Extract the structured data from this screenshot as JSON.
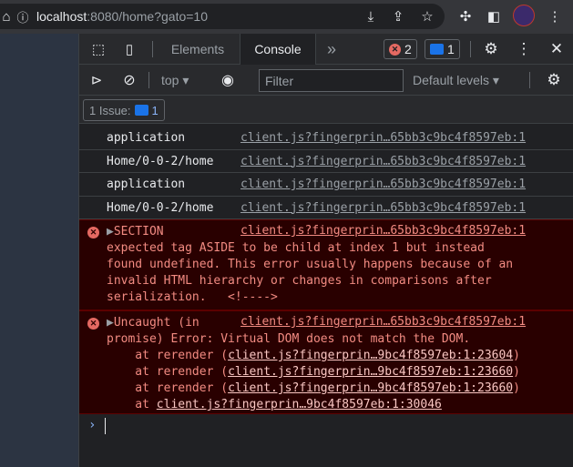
{
  "browser": {
    "url_host": "localhost",
    "url_rest": ":8080/home?gato=10"
  },
  "devtools": {
    "tabs": [
      "Elements",
      "Console"
    ],
    "more_tabs": "»",
    "error_count": "2",
    "message_count": "1",
    "context": "top",
    "filter_placeholder": "Filter",
    "levels": "Default levels",
    "issues_label": "1 Issue:",
    "issues_count": "1"
  },
  "console": {
    "logs": [
      {
        "message": "application",
        "source": "client.js?fingerprin…65bb3c9bc4f8597eb:1"
      },
      {
        "message": "Home/0-0-2/home",
        "source": "client.js?fingerprin…65bb3c9bc4f8597eb:1"
      },
      {
        "message": "application",
        "source": "client.js?fingerprin…65bb3c9bc4f8597eb:1"
      },
      {
        "message": "Home/0-0-2/home",
        "source": "client.js?fingerprin…65bb3c9bc4f8597eb:1"
      }
    ],
    "error1": {
      "head": "SECTION",
      "source": "client.js?fingerprin…65bb3c9bc4f8597eb:1",
      "lines": [
        "expected tag ASIDE to be child at index 1 but instead",
        "found undefined. This error usually happens because of an",
        "invalid HTML hierarchy or changes in comparisons after",
        "serialization.   <!---->"
      ]
    },
    "error2": {
      "head": "Uncaught (in",
      "source": "client.js?fingerprin…65bb3c9bc4f8597eb:1",
      "line2": "promise) Error: Virtual DOM does not match the DOM.",
      "stack": [
        {
          "prefix": "    at rerender (",
          "link": "client.js?fingerprin…9bc4f8597eb:1:23604",
          "suffix": ")"
        },
        {
          "prefix": "    at rerender (",
          "link": "client.js?fingerprin…9bc4f8597eb:1:23660",
          "suffix": ")"
        },
        {
          "prefix": "    at rerender (",
          "link": "client.js?fingerprin…9bc4f8597eb:1:23660",
          "suffix": ")"
        },
        {
          "prefix": "    at ",
          "link": "client.js?fingerprin…9bc4f8597eb:1:30046",
          "suffix": ""
        }
      ]
    },
    "prompt": "›"
  },
  "colors": {
    "error_bg": "#290000",
    "error_text": "#f28b82",
    "accent": "#1a73e8"
  }
}
